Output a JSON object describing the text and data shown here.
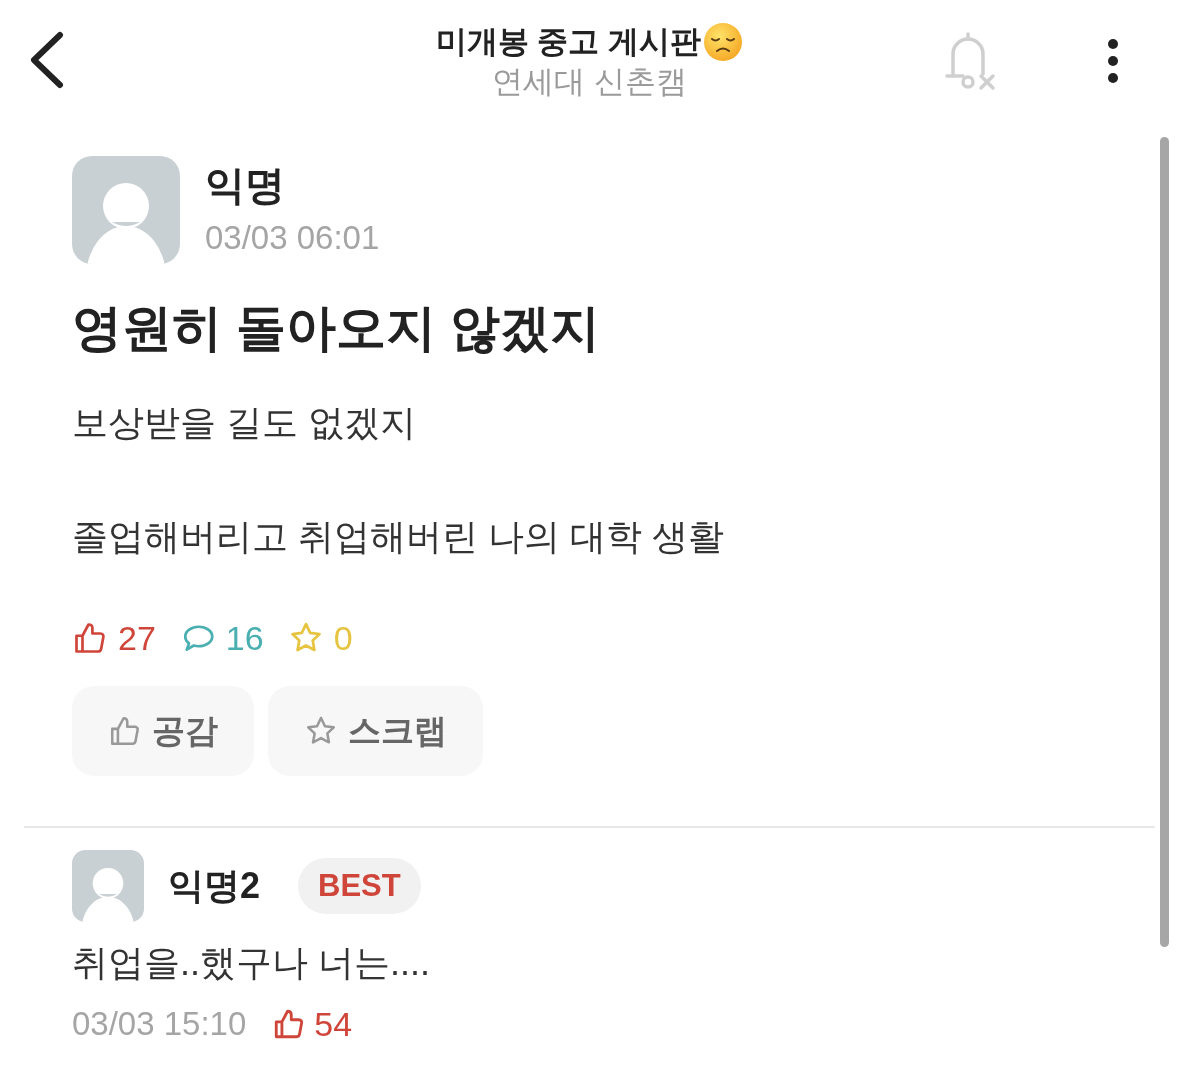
{
  "header": {
    "title": "미개봉 중고 게시판",
    "subtitle": "연세대 신촌캠",
    "notifications_on": false
  },
  "post": {
    "author": "익명",
    "time": "03/03 06:01",
    "title": "영원히 돌아오지 않겠지",
    "paragraphs": [
      "보상받을 길도 없겠지",
      "졸업해버리고 취업해버린 나의 대학 생활"
    ],
    "stats": [
      {
        "kind": "likes",
        "count": "27",
        "color": "#d0453a"
      },
      {
        "kind": "comments",
        "count": "16",
        "color": "#4aafb0"
      },
      {
        "kind": "scraps",
        "count": "0",
        "color": "#e6c440"
      }
    ],
    "actions": [
      {
        "kind": "like",
        "label": "공감"
      },
      {
        "kind": "scrap",
        "label": "스크랩"
      }
    ]
  },
  "comments": [
    {
      "author": "익명2",
      "best": true,
      "badge": "BEST",
      "text": "취업을..했구나 너는....",
      "time": "03/03 15:10",
      "likes": "54"
    }
  ]
}
